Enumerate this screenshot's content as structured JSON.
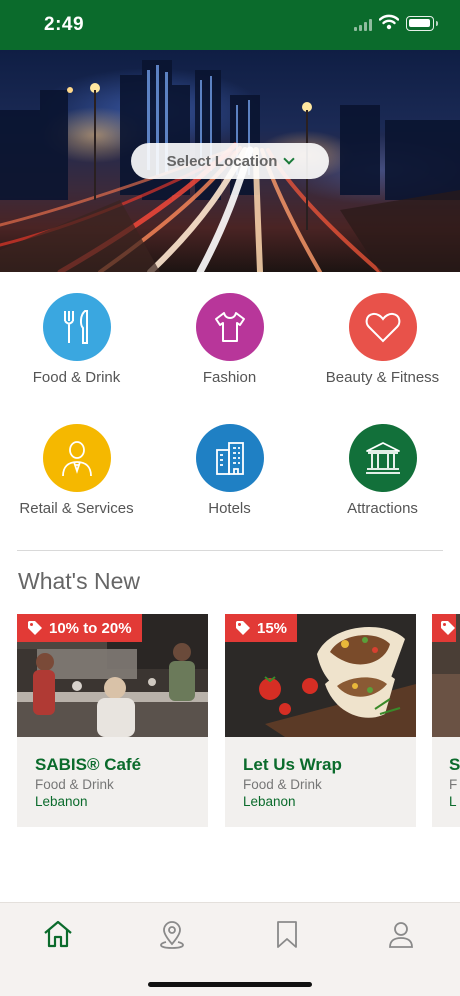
{
  "status_bar": {
    "time": "2:49"
  },
  "hero": {
    "location_label": "Select Location"
  },
  "categories": [
    {
      "label": "Food & Drink",
      "icon": "fork-knife-icon",
      "color": "#3aa7e0"
    },
    {
      "label": "Fashion",
      "icon": "tshirt-icon",
      "color": "#b8369a"
    },
    {
      "label": "Beauty & Fitness",
      "icon": "heart-icon",
      "color": "#e8524a"
    },
    {
      "label": "Retail & Services",
      "icon": "person-icon",
      "color": "#f5b800"
    },
    {
      "label": "Hotels",
      "icon": "building-icon",
      "color": "#1f80c4"
    },
    {
      "label": "Attractions",
      "icon": "landmark-icon",
      "color": "#12703a"
    }
  ],
  "whats_new": {
    "title": "What's New",
    "cards": [
      {
        "discount": "10% to 20%",
        "name": "SABIS® Café",
        "category": "Food & Drink",
        "location": "Lebanon"
      },
      {
        "discount": "15%",
        "name": "Let Us Wrap",
        "category": "Food & Drink",
        "location": "Lebanon"
      },
      {
        "discount": "",
        "name": "S",
        "category": "F",
        "location": "L"
      }
    ]
  },
  "tab_bar": [
    {
      "icon": "home-icon",
      "active": true
    },
    {
      "icon": "map-pin-icon",
      "active": false
    },
    {
      "icon": "bookmark-icon",
      "active": false
    },
    {
      "icon": "profile-icon",
      "active": false
    }
  ],
  "colors": {
    "brand_green": "#0b6b2c",
    "badge_red": "#e23a36",
    "card_bg": "#f2f0ee"
  }
}
